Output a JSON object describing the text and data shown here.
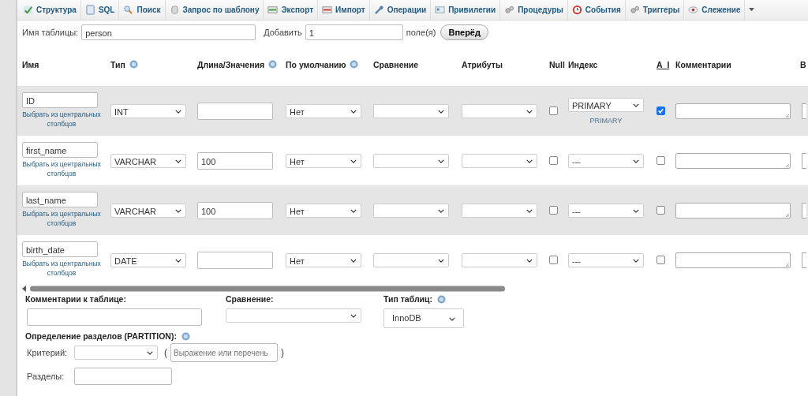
{
  "tabs": [
    {
      "label": "Структура"
    },
    {
      "label": "SQL"
    },
    {
      "label": "Поиск"
    },
    {
      "label": "Запрос по шаблону"
    },
    {
      "label": "Экспорт"
    },
    {
      "label": "Импорт"
    },
    {
      "label": "Операции"
    },
    {
      "label": "Привилегии"
    },
    {
      "label": "Процедуры"
    },
    {
      "label": "События"
    },
    {
      "label": "Триггеры"
    },
    {
      "label": "Слежение"
    }
  ],
  "table_form": {
    "name_label": "Имя таблицы:",
    "name_value": "person",
    "add_label": "Добавить",
    "add_value": "1",
    "fields_label": "поле(я)",
    "go_button": "Вперёд"
  },
  "columns": [
    {
      "label": "Имя",
      "kind": "plain"
    },
    {
      "label": "Тип",
      "kind": "help"
    },
    {
      "label": "Длина/Значения",
      "kind": "help"
    },
    {
      "label": "По умолчанию",
      "kind": "help"
    },
    {
      "label": "Сравнение",
      "kind": "plain"
    },
    {
      "label": "Атрибуты",
      "kind": "plain"
    },
    {
      "label": "Null",
      "kind": "plain"
    },
    {
      "label": "Индекс",
      "kind": "plain"
    },
    {
      "label": "A_I",
      "kind": "plain"
    },
    {
      "label": "Комментарии",
      "kind": "plain"
    },
    {
      "label": "В",
      "kind": "plain"
    }
  ],
  "rows": [
    {
      "name": "ID",
      "link": "Выбрать из центральных столбцов",
      "type": "INT",
      "length": "",
      "default": "Нет",
      "null": false,
      "index": "PRIMARY",
      "index_note": "PRIMARY",
      "ai": true
    },
    {
      "name": "first_name",
      "link": "Выбрать из центральных столбцов",
      "type": "VARCHAR",
      "length": "100",
      "default": "Нет",
      "null": false,
      "index": "---",
      "ai": false
    },
    {
      "name": "last_name",
      "link": "Выбрать из центральных столбцов",
      "type": "VARCHAR",
      "length": "100",
      "default": "Нет",
      "null": false,
      "index": "---",
      "ai": false
    },
    {
      "name": "birth_date",
      "link": "Выбрать из центральных столбцов",
      "type": "DATE",
      "length": "",
      "default": "Нет",
      "null": false,
      "index": "---",
      "ai": false
    }
  ],
  "options": {
    "comments_label": "Комментарии к таблице:",
    "collation_label": "Сравнение:",
    "engine_label": "Тип таблиц:",
    "engine_value": "InnoDB",
    "partition_label": "Определение разделов (PARTITION):",
    "criterion_label": "Критерий:",
    "open_paren": "(",
    "expression_placeholder": "Выражение или перечень",
    "close_paren": ")",
    "partitions_label": "Разделы:"
  }
}
